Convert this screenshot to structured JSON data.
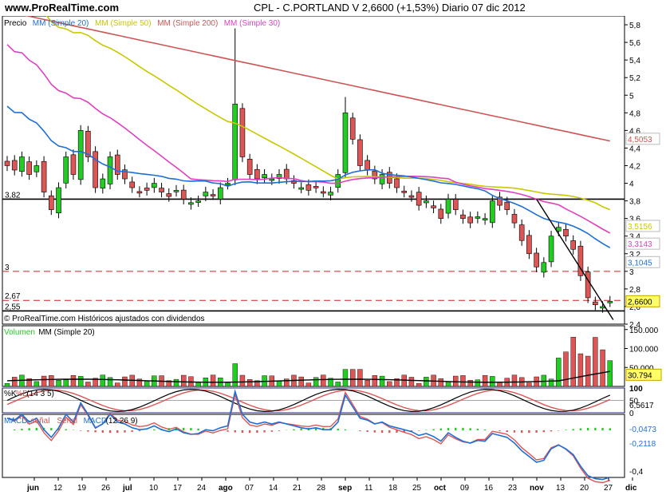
{
  "header": {
    "site": "www.ProRealTime.com",
    "title": "CPL - C.PORTLAND V   2,6600 (+1,53%)   Diario  07 dic 2012"
  },
  "colors": {
    "up": "#22cc22",
    "down": "#dd5555",
    "ma20": "#1e6fd6",
    "ma50": "#c8c800",
    "ma200": "#cc5555",
    "ma30": "#e040c0",
    "hline": "#000000",
    "dash": "#cc2222",
    "highlight": "#ffff66"
  },
  "price_panel": {
    "legend": [
      {
        "text": "Precio",
        "color": "#000000"
      },
      {
        "text": "MM (Simple 20)",
        "color": "#1e6fd6"
      },
      {
        "text": "MM (Simple 50)",
        "color": "#c8c800"
      },
      {
        "text": "MM (Simple 200)",
        "color": "#cc5555"
      },
      {
        "text": "MM (Simple 30)",
        "color": "#e040c0"
      }
    ],
    "footer": "© ProRealTime.com Históricos ajustados con dividendos",
    "yticks": [
      "5,8",
      "5,6",
      "5,4",
      "5,2",
      "5",
      "4,8",
      "4,6",
      "4,4",
      "4,2",
      "4",
      "3,8",
      "3,6",
      "3,4",
      "3,2",
      "3",
      "2,8",
      "2,6",
      "2,4"
    ],
    "levels": [
      {
        "label": "3,82",
        "value": 3.82,
        "style": "solid"
      },
      {
        "label": "3",
        "value": 3.0,
        "style": "dash"
      },
      {
        "label": "2,67",
        "value": 2.67,
        "style": "dash"
      },
      {
        "label": "2,55",
        "value": 2.55,
        "style": "solid"
      }
    ],
    "value_tags": [
      {
        "text": "4,5053",
        "value": 4.5053,
        "color": "#cc5555"
      },
      {
        "text": "3,5156",
        "value": 3.5156,
        "color": "#c8c800"
      },
      {
        "text": "3,3143",
        "value": 3.3143,
        "color": "#e040c0"
      },
      {
        "text": "3,1045",
        "value": 3.1045,
        "color": "#1e6fd6"
      },
      {
        "text": "2,6600",
        "value": 2.66,
        "color": "#000000",
        "highlight": true
      }
    ]
  },
  "volume_panel": {
    "legend": [
      {
        "text": "Volumen",
        "color": "#22cc22"
      },
      {
        "text": "MM (Simple 20)",
        "color": "#000000"
      }
    ],
    "yticks": [
      "150.000",
      "100.000",
      "50.000"
    ],
    "value_tag": "30.794"
  },
  "stoch_panel": {
    "legend": [
      {
        "text": "%K",
        "color": "#000000"
      },
      {
        "text": "%D",
        "color": "#cc5555"
      },
      {
        "text": "(14 3 5)",
        "color": "#000000"
      }
    ],
    "yticks": [
      "100",
      "50",
      "0"
    ],
    "value_tag": "6,5617"
  },
  "macd_panel": {
    "legend": [
      {
        "text": "MACD-",
        "color": "#1e6fd6"
      },
      {
        "text": ", señal",
        "color": "#cc5555"
      },
      {
        "text": " Señal",
        "color": "#cc5555"
      },
      {
        "text": " MACD",
        "color": "#1e6fd6"
      },
      {
        "text": " (12 26 9)",
        "color": "#000000"
      }
    ],
    "yticks": [
      "-0,4"
    ],
    "value_tags": [
      {
        "text": "-0,0473",
        "color": "#1e6fd6"
      },
      {
        "text": "-0,2118",
        "color": "#1e6fd6"
      }
    ]
  },
  "x_axis": {
    "labels": [
      {
        "text": "jun",
        "bold": true
      },
      {
        "text": "12"
      },
      {
        "text": "19"
      },
      {
        "text": "26"
      },
      {
        "text": "jul",
        "bold": true
      },
      {
        "text": "10"
      },
      {
        "text": "17"
      },
      {
        "text": "24"
      },
      {
        "text": "ago",
        "bold": true
      },
      {
        "text": "07"
      },
      {
        "text": "14"
      },
      {
        "text": "21"
      },
      {
        "text": "28"
      },
      {
        "text": "sep",
        "bold": true
      },
      {
        "text": "11"
      },
      {
        "text": "18"
      },
      {
        "text": "25"
      },
      {
        "text": "oct",
        "bold": true
      },
      {
        "text": "09"
      },
      {
        "text": "16"
      },
      {
        "text": "23"
      },
      {
        "text": "nov",
        "bold": true
      },
      {
        "text": "13"
      },
      {
        "text": "20"
      },
      {
        "text": "27"
      },
      {
        "text": "dic",
        "bold": true
      }
    ]
  },
  "chart_data": {
    "type": "candlestick",
    "ylim": [
      2.4,
      5.9
    ],
    "series": [
      {
        "name": "Precio",
        "close": [
          4.2,
          4.15,
          4.3,
          4.1,
          4.2,
          3.9,
          3.7,
          3.95,
          4.3,
          4.1,
          4.6,
          4.3,
          3.95,
          4.05,
          4.3,
          4.1,
          4.05,
          3.95,
          3.9,
          3.92,
          4.0,
          3.9,
          3.85,
          3.92,
          3.82,
          3.78,
          3.8,
          3.9,
          3.87,
          3.95,
          4.0,
          4.9,
          4.3,
          4.1,
          4.05,
          4.1,
          4.05,
          4.1,
          4.05,
          4.0,
          3.95,
          3.92,
          3.95,
          3.9,
          3.9,
          4.1,
          4.8,
          4.5,
          4.2,
          4.15,
          4.05,
          4.1,
          4.0,
          3.95,
          3.9,
          3.85,
          3.75,
          3.8,
          3.72,
          3.6,
          3.82,
          3.7,
          3.6,
          3.55,
          3.62,
          3.6,
          3.8,
          3.75,
          3.7,
          3.55,
          3.35,
          3.2,
          3.05,
          3.1,
          3.4,
          3.5,
          3.4,
          3.25,
          2.95,
          2.7,
          2.62,
          2.6,
          2.66
        ]
      }
    ],
    "sma": {
      "MM (Simple 20)": 3.1045,
      "MM (Simple 50)": 3.5156,
      "MM (Simple 30)": 3.3143,
      "MM (Simple 200)": 4.5053
    }
  }
}
